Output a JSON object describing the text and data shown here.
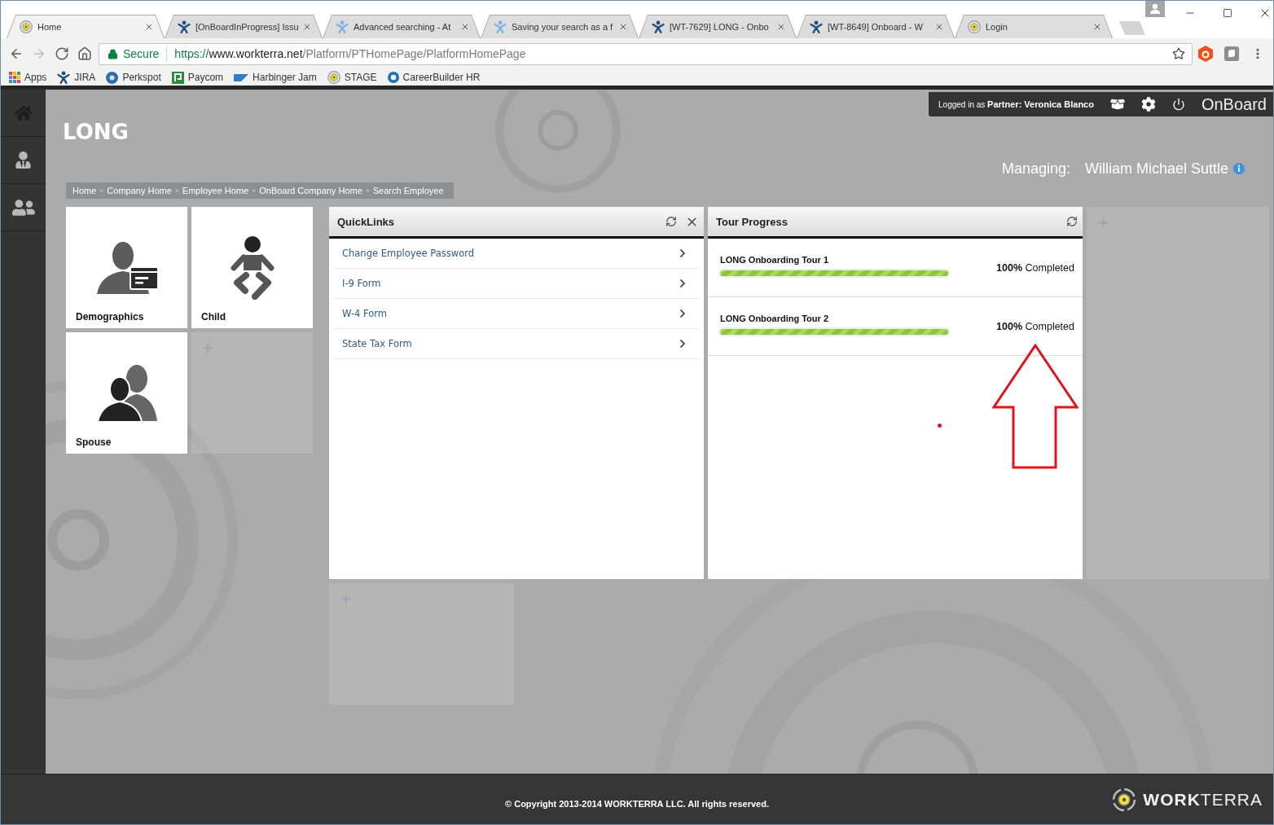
{
  "browser": {
    "tabs": [
      {
        "title": "Home",
        "kind": "target",
        "selected": true
      },
      {
        "title": "[OnBoardInProgress] Issu",
        "kind": "figure",
        "selected": false
      },
      {
        "title": "Advanced searching - At",
        "kind": "figure-faded",
        "selected": false
      },
      {
        "title": "Saving your search as a f",
        "kind": "figure-faded",
        "selected": false
      },
      {
        "title": "[WT-7629] LONG - Onbo",
        "kind": "figure",
        "selected": false
      },
      {
        "title": "[WT-8649] Onboard - W",
        "kind": "figure",
        "selected": false
      },
      {
        "title": "Login",
        "kind": "target",
        "selected": false
      }
    ],
    "nav_buttons": [
      {
        "kind": "back",
        "disabled": false
      },
      {
        "kind": "forward",
        "disabled": true
      },
      {
        "kind": "reload",
        "disabled": false
      },
      {
        "kind": "home",
        "disabled": false
      }
    ],
    "address": {
      "security": "Secure",
      "url": {
        "scheme": "https://",
        "host": "www.workterra.net",
        "path": "/Platform/PTHomePage/PlatformHomePage"
      }
    },
    "bookmarks": [
      {
        "label": "Apps",
        "kind": "grid"
      },
      {
        "label": "JIRA",
        "kind": "figure"
      },
      {
        "label": "Perkspot",
        "kind": "disc"
      },
      {
        "label": "Paycom",
        "kind": "square"
      },
      {
        "label": "Harbinger Jam",
        "kind": "trapezoid"
      },
      {
        "label": "STAGE",
        "kind": "target"
      },
      {
        "label": "CareerBuilder HR",
        "kind": "ring"
      }
    ]
  },
  "top_bar": {
    "login": "Logged in as **Partner: Veronica Blanco**",
    "app_name": "OnBoard"
  },
  "page_title": "LONG",
  "managing": {
    "label": "Managing:",
    "name": "William Michael Suttle"
  },
  "breadcrumb": {
    "separator": "»",
    "items": [
      "Home",
      "Company Home",
      "Employee Home",
      "OnBoard Company Home",
      "Search Employee"
    ]
  },
  "tiles": [
    {
      "kind": "demographics",
      "label": "Demographics"
    },
    {
      "kind": "child",
      "label": "Child"
    },
    {
      "kind": "spouse",
      "label": "Spouse"
    },
    {
      "kind": "add"
    }
  ],
  "quicklinks": {
    "title": "QuickLinks",
    "items": [
      "Change Employee Password",
      "I-9 Form",
      "W-4 Form",
      "State Tax Form"
    ]
  },
  "tour_progress": {
    "title": "Tour Progress",
    "tours": [
      {
        "name": "LONG Onboarding Tour 1",
        "level": 1,
        "completion": "**100%** Completed"
      },
      {
        "name": "LONG Onboarding Tour 2",
        "level": 1,
        "completion": "**100%** Completed"
      }
    ]
  },
  "footer": {
    "copyright": "© Copyright 2013-2014 WORKTERRA LLC. All rights reserved.",
    "logo_text": "**WORK**TERRA"
  }
}
